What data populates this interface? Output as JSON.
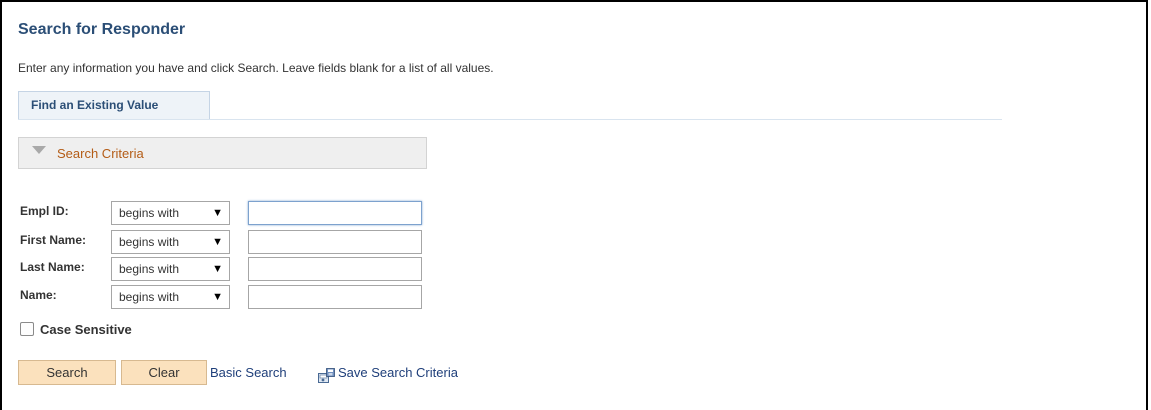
{
  "page": {
    "title": "Search for Responder",
    "instructions": "Enter any information you have and click Search. Leave fields blank for a list of all values."
  },
  "tabs": [
    {
      "label": "Find an Existing Value"
    }
  ],
  "search_criteria": {
    "label": "Search Criteria",
    "fields": [
      {
        "label": "Empl ID:",
        "operator": "begins with",
        "value": ""
      },
      {
        "label": "First Name:",
        "operator": "begins with",
        "value": ""
      },
      {
        "label": "Last Name:",
        "operator": "begins with",
        "value": ""
      },
      {
        "label": "Name:",
        "operator": "begins with",
        "value": ""
      }
    ],
    "case_sensitive": {
      "label": "Case Sensitive",
      "checked": false
    }
  },
  "actions": {
    "search_label": "Search",
    "clear_label": "Clear",
    "basic_search_label": "Basic Search",
    "save_criteria_label": "Save Search Criteria"
  },
  "icons": {
    "collapse": "triangle-down-icon",
    "caret": "dropdown-caret-icon",
    "save": "save-search-icon"
  },
  "colors": {
    "title": "#2b4e76",
    "criteria_label": "#b45c16",
    "button_bg": "#fbe1bd",
    "link": "#1f3f7a"
  }
}
